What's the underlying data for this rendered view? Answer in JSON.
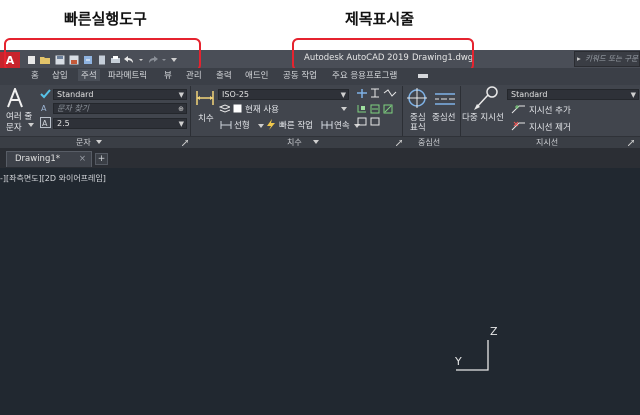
{
  "annotations": {
    "qat_label": "빠른실행도구",
    "titlebar_label": "제목표시줄"
  },
  "app": {
    "logo": "A",
    "product": "Autodesk AutoCAD 2019",
    "document": "Drawing1.dwg",
    "search_placeholder": "키워드 또는 구문"
  },
  "ribbon_tabs": [
    "홈",
    "삽입",
    "주석",
    "파라메트릭",
    "뷰",
    "관리",
    "출력",
    "애드인",
    "공동 작업",
    "주요 응용프로그램"
  ],
  "ribbon": {
    "text": {
      "multiline_label_line1": "여러 줄",
      "multiline_label_line2": "문자",
      "style": "Standard",
      "find_placeholder": "문자 찾기",
      "height": "2.5",
      "panel_title": "문자"
    },
    "dimensions": {
      "dim_label": "치수",
      "style": "ISO-25",
      "layer": "현재 사용",
      "linear": "선형",
      "quick": "빠른 작업",
      "continue": "연속",
      "panel_title": "치수"
    },
    "centerlines": {
      "center_mark_line1": "중심",
      "center_mark_line2": "표식",
      "centerline": "중심선",
      "panel_title": "중심선"
    },
    "leaders": {
      "multileader": "다중 지시선",
      "style": "Standard",
      "add": "지시선 추가",
      "remove": "지시선 제거",
      "panel_title": "지시선"
    }
  },
  "document_tab": {
    "name": "Drawing1*",
    "close": "×",
    "new": "+"
  },
  "viewport": {
    "label": "-][좌측면도][2D 와이어프레임]",
    "ucs_x": "Y",
    "ucs_y": "Z"
  },
  "colors": {
    "highlight": "#e5232f",
    "logo_red": "#c8242c",
    "canvas": "#212830",
    "ribbon": "#41454d"
  }
}
